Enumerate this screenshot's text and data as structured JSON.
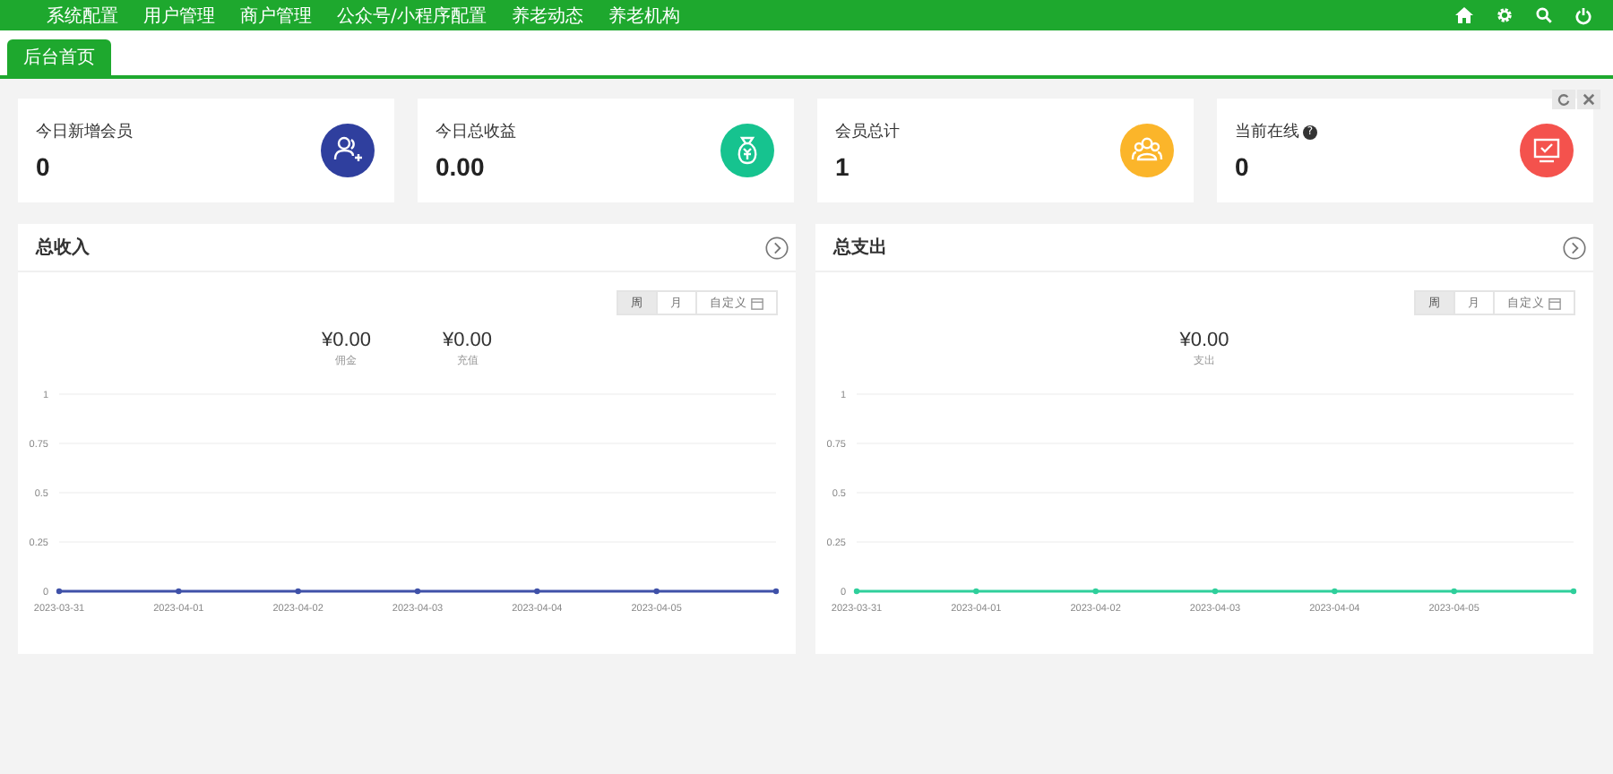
{
  "top_menu": [
    {
      "label": "系统配置"
    },
    {
      "label": "用户管理"
    },
    {
      "label": "商户管理"
    },
    {
      "label": "公众号/小程序配置"
    },
    {
      "label": "养老动态"
    },
    {
      "label": "养老机构"
    }
  ],
  "tabs": [
    {
      "label": "后台首页",
      "selected": true
    }
  ],
  "stats": [
    {
      "label": "今日新增会员",
      "value": "0",
      "color": "#2f3f9e",
      "kind": "newmembers"
    },
    {
      "label": "今日总收益",
      "value": "0.00",
      "color": "#16c38f",
      "kind": "income"
    },
    {
      "label": "会员总计",
      "value": "1",
      "color": "#fbb52a",
      "kind": "members"
    },
    {
      "label": "当前在线",
      "value": "0",
      "color": "#f4524d",
      "kind": "online",
      "help": "?"
    }
  ],
  "panels": [
    {
      "title": "总收入",
      "periods": [
        {
          "label": "周",
          "selected": true
        },
        {
          "label": "月",
          "selected": false
        },
        {
          "label": "自定义",
          "selected": false
        }
      ],
      "totals": [
        {
          "amount": "¥0.00",
          "label": "佣金"
        },
        {
          "amount": "¥0.00",
          "label": "充值"
        }
      ],
      "chart_data": {
        "type": "line",
        "categories": [
          "2023-03-31",
          "2023-04-01",
          "2023-04-02",
          "2023-04-03",
          "2023-04-04",
          "2023-04-05",
          null
        ],
        "ylim": [
          0,
          1
        ],
        "yticks": [
          0,
          0.25,
          0.5,
          0.75,
          1
        ],
        "grid": true,
        "series": [
          {
            "color": "#3f51a8",
            "marker": true,
            "values": [
              0,
              0,
              0,
              0,
              0,
              0,
              0
            ]
          }
        ]
      }
    },
    {
      "title": "总支出",
      "periods": [
        {
          "label": "周",
          "selected": true
        },
        {
          "label": "月",
          "selected": false
        },
        {
          "label": "自定义",
          "selected": false
        }
      ],
      "totals": [
        {
          "amount": "¥0.00",
          "label": "支出"
        }
      ],
      "chart_data": {
        "type": "line",
        "categories": [
          "2023-03-31",
          "2023-04-01",
          "2023-04-02",
          "2023-04-03",
          "2023-04-04",
          "2023-04-05",
          null
        ],
        "ylim": [
          0,
          1
        ],
        "yticks": [
          0,
          0.25,
          0.5,
          0.75,
          1
        ],
        "grid": true,
        "series": [
          {
            "color": "#2fcf9b",
            "marker": true,
            "values": [
              0,
              0,
              0,
              0,
              0,
              0,
              0
            ]
          }
        ]
      }
    }
  ]
}
